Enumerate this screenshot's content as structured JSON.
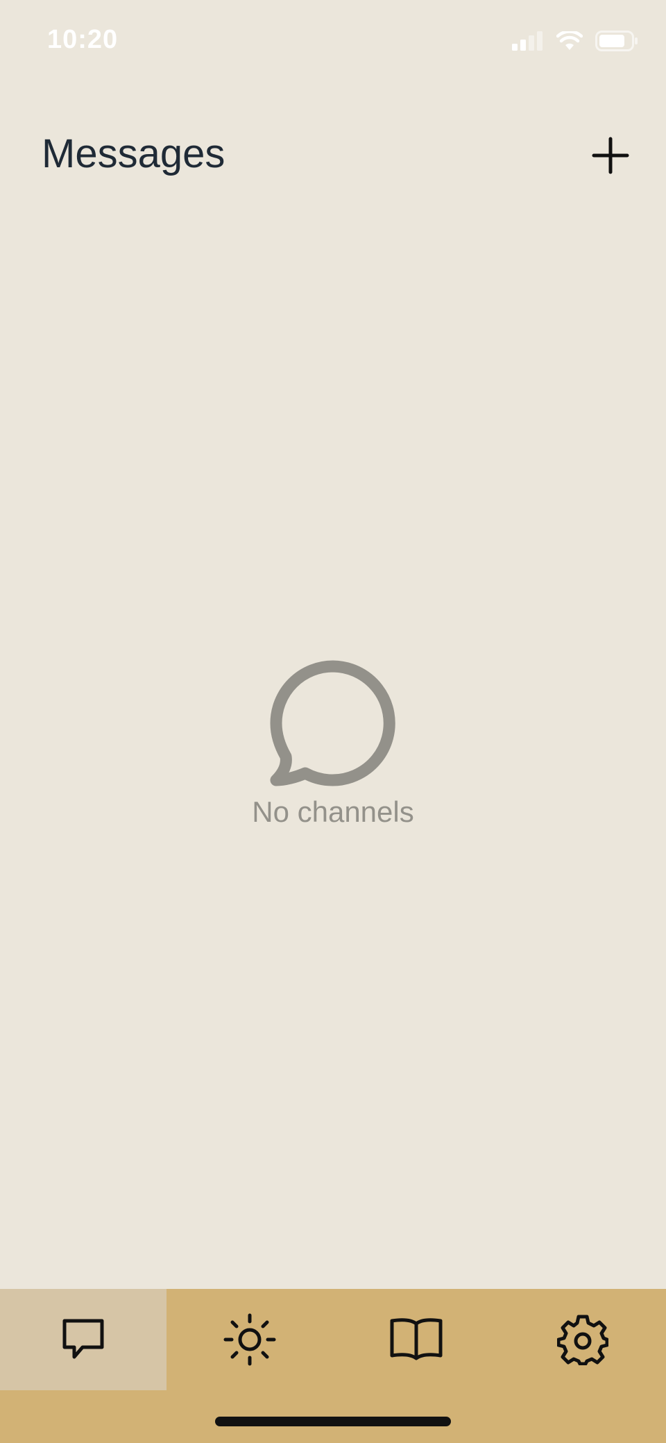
{
  "status_bar": {
    "time": "10:20",
    "icons": [
      "signal-icon",
      "wifi-icon",
      "battery-icon"
    ]
  },
  "header": {
    "title": "Messages",
    "add_icon": "plus-icon"
  },
  "empty_state": {
    "icon": "chat-bubble-icon",
    "text": "No channels"
  },
  "tab_bar": {
    "tabs": [
      {
        "icon": "chat-icon",
        "active": true
      },
      {
        "icon": "sun-icon",
        "active": false
      },
      {
        "icon": "book-icon",
        "active": false
      },
      {
        "icon": "gear-icon",
        "active": false
      }
    ]
  },
  "colors": {
    "background": "#ebe6db",
    "tab_bar": "#d2b275",
    "tab_active": "#d6c5a6",
    "title": "#1f2a36",
    "muted": "#93918a"
  }
}
